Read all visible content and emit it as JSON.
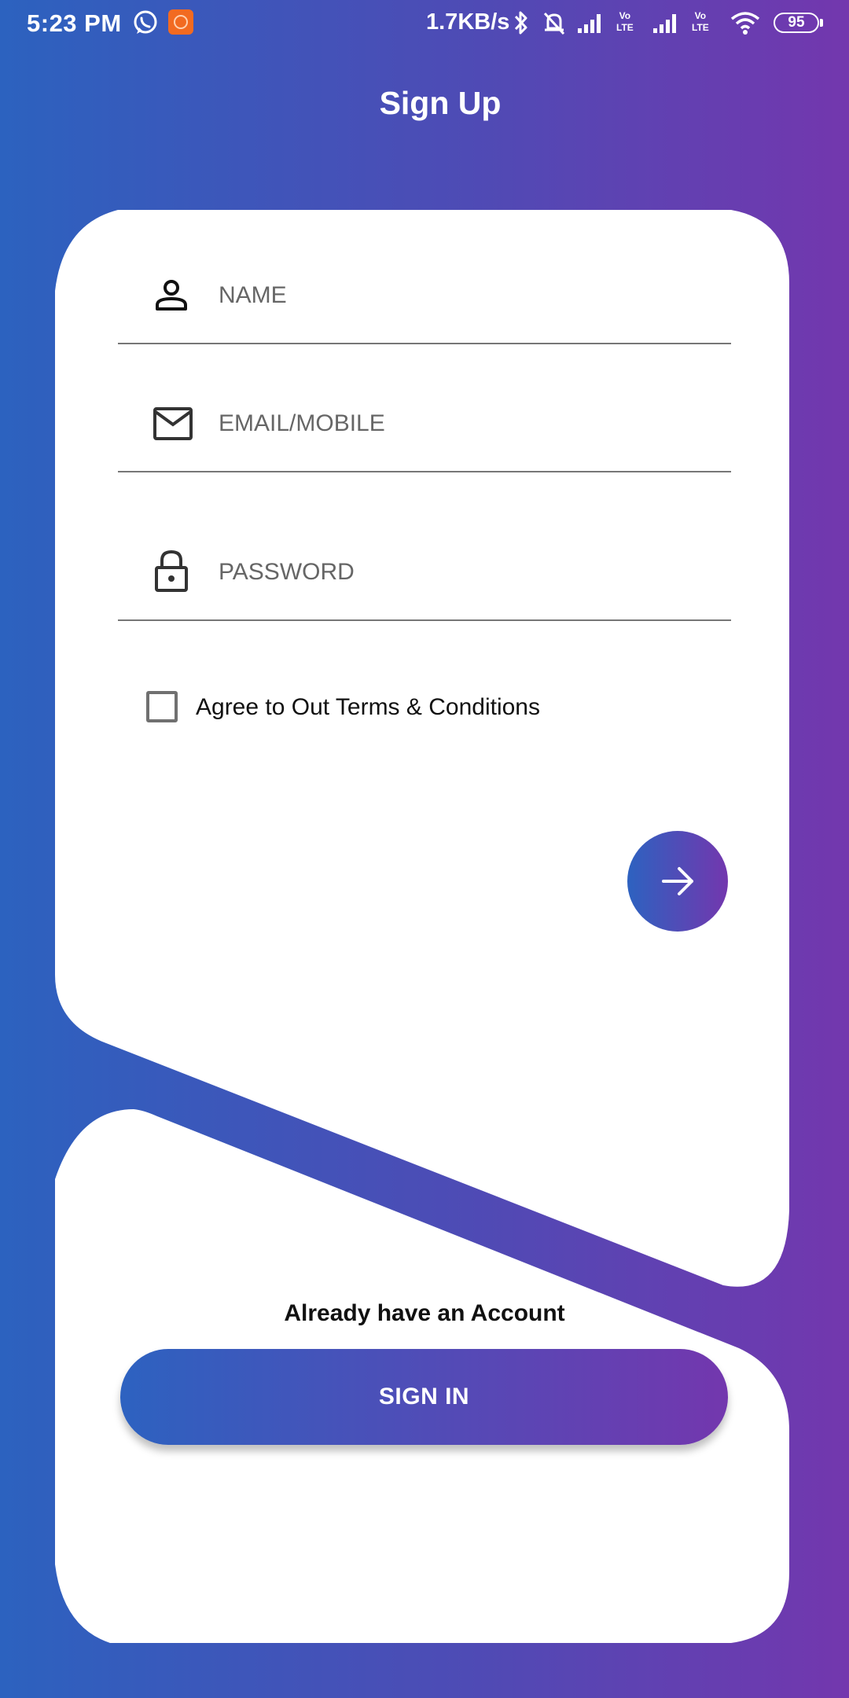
{
  "status_bar": {
    "time": "5:23 PM",
    "network_speed": "1.7KB/s",
    "volte_label_1": "Vo LTE",
    "volte_label_2": "Vo LTE",
    "battery": "95"
  },
  "header": {
    "title": "Sign Up"
  },
  "form": {
    "name": {
      "placeholder": "NAME",
      "value": "",
      "icon": "person-icon"
    },
    "email": {
      "placeholder": "EMAIL/MOBILE",
      "value": "",
      "icon": "mail-icon"
    },
    "password": {
      "placeholder": "PASSWORD",
      "value": "",
      "icon": "lock-icon"
    },
    "terms": {
      "label": "Agree to Out Terms & Conditions",
      "checked": false
    },
    "next_icon": "arrow-right-icon"
  },
  "signin": {
    "prompt": "Already have an Account",
    "button_label": "SIGN IN"
  },
  "colors": {
    "gradient_start": "#2c62bf",
    "gradient_end": "#7337ae",
    "card": "#ffffff"
  }
}
